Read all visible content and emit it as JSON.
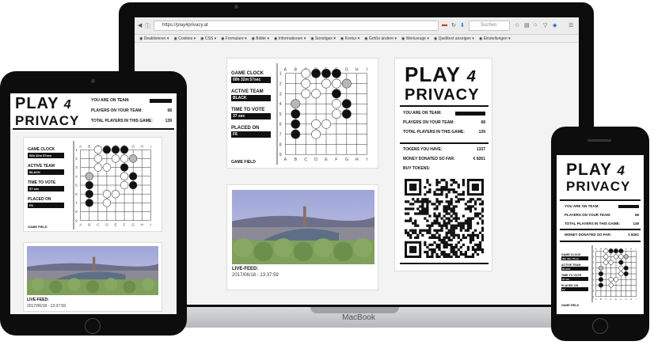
{
  "device_label": "MacBook",
  "browser": {
    "url": "https://play4privacy.at",
    "search_placeholder": "Suchen",
    "bookmarks": [
      "Deaktivieren",
      "Cookies",
      "CSS",
      "Formulare",
      "Bilder",
      "Informationen",
      "Sonstiges",
      "Kontur",
      "Größe ändern",
      "Werkzeuge",
      "Quelltext anzeigen",
      "Einstellungen"
    ]
  },
  "logo": {
    "line1": "PLAY",
    "numeral": "4",
    "line2": "PRIVACY"
  },
  "team_info": {
    "you_are_on_team_label": "YOU ARE ON TEAM:",
    "players_on_team_label": "PLAYERS ON YOUR TEAM:",
    "players_on_team_value": "68",
    "total_players_label": "TOTAL PLAYERS IN THIS GAME:",
    "total_players_value": "139"
  },
  "tokens": {
    "tokens_label": "TOKENS YOU HAVE:",
    "tokens_value": "1337",
    "donated_label": "MONEY DONATED SO FAR:",
    "donated_value": "€ 8261",
    "buy_label": "BUY TOKENS:"
  },
  "game": {
    "clock_label": "GAME CLOCK",
    "clock_value": "00h 32m 57sec",
    "active_team_label": "ACTIVE TEAM",
    "active_team_value": "BLACK",
    "time_to_vote_label": "TIME TO VOTE",
    "time_to_vote_value": "37 sec",
    "placed_on_label": "PLACED ON",
    "placed_on_value": "F6",
    "field_caption": "GAME FIELD",
    "columns": [
      "A",
      "B",
      "C",
      "D",
      "E",
      "F",
      "G",
      "H",
      "I"
    ],
    "rows": [
      "1",
      "2",
      "3",
      "4",
      "5",
      "6",
      "7",
      "8",
      "9"
    ],
    "stones": [
      {
        "col": 2,
        "row": 0,
        "color": "white"
      },
      {
        "col": 3,
        "row": 0,
        "color": "black"
      },
      {
        "col": 4,
        "row": 0,
        "color": "black"
      },
      {
        "col": 5,
        "row": 0,
        "color": "black"
      },
      {
        "col": 2,
        "row": 1,
        "color": "white"
      },
      {
        "col": 4,
        "row": 1,
        "color": "white"
      },
      {
        "col": 5,
        "row": 1,
        "color": "white"
      },
      {
        "col": 6,
        "row": 1,
        "color": "grey"
      },
      {
        "col": 2,
        "row": 2,
        "color": "white"
      },
      {
        "col": 3,
        "row": 2,
        "color": "white"
      },
      {
        "col": 5,
        "row": 2,
        "color": "black"
      },
      {
        "col": 1,
        "row": 3,
        "color": "grey"
      },
      {
        "col": 5,
        "row": 3,
        "color": "white"
      },
      {
        "col": 6,
        "row": 3,
        "color": "black"
      },
      {
        "col": 1,
        "row": 4,
        "color": "black"
      },
      {
        "col": 5,
        "row": 4,
        "color": "white"
      },
      {
        "col": 6,
        "row": 4,
        "color": "black"
      },
      {
        "col": 1,
        "row": 5,
        "color": "black"
      },
      {
        "col": 3,
        "row": 5,
        "color": "white"
      },
      {
        "col": 4,
        "row": 5,
        "color": "white"
      },
      {
        "col": 1,
        "row": 6,
        "color": "black"
      },
      {
        "col": 3,
        "row": 6,
        "color": "white"
      }
    ]
  },
  "live_feed": {
    "label": "LIVE-FEED:",
    "timestamp": "2017/06/18 - 13:37:59"
  }
}
